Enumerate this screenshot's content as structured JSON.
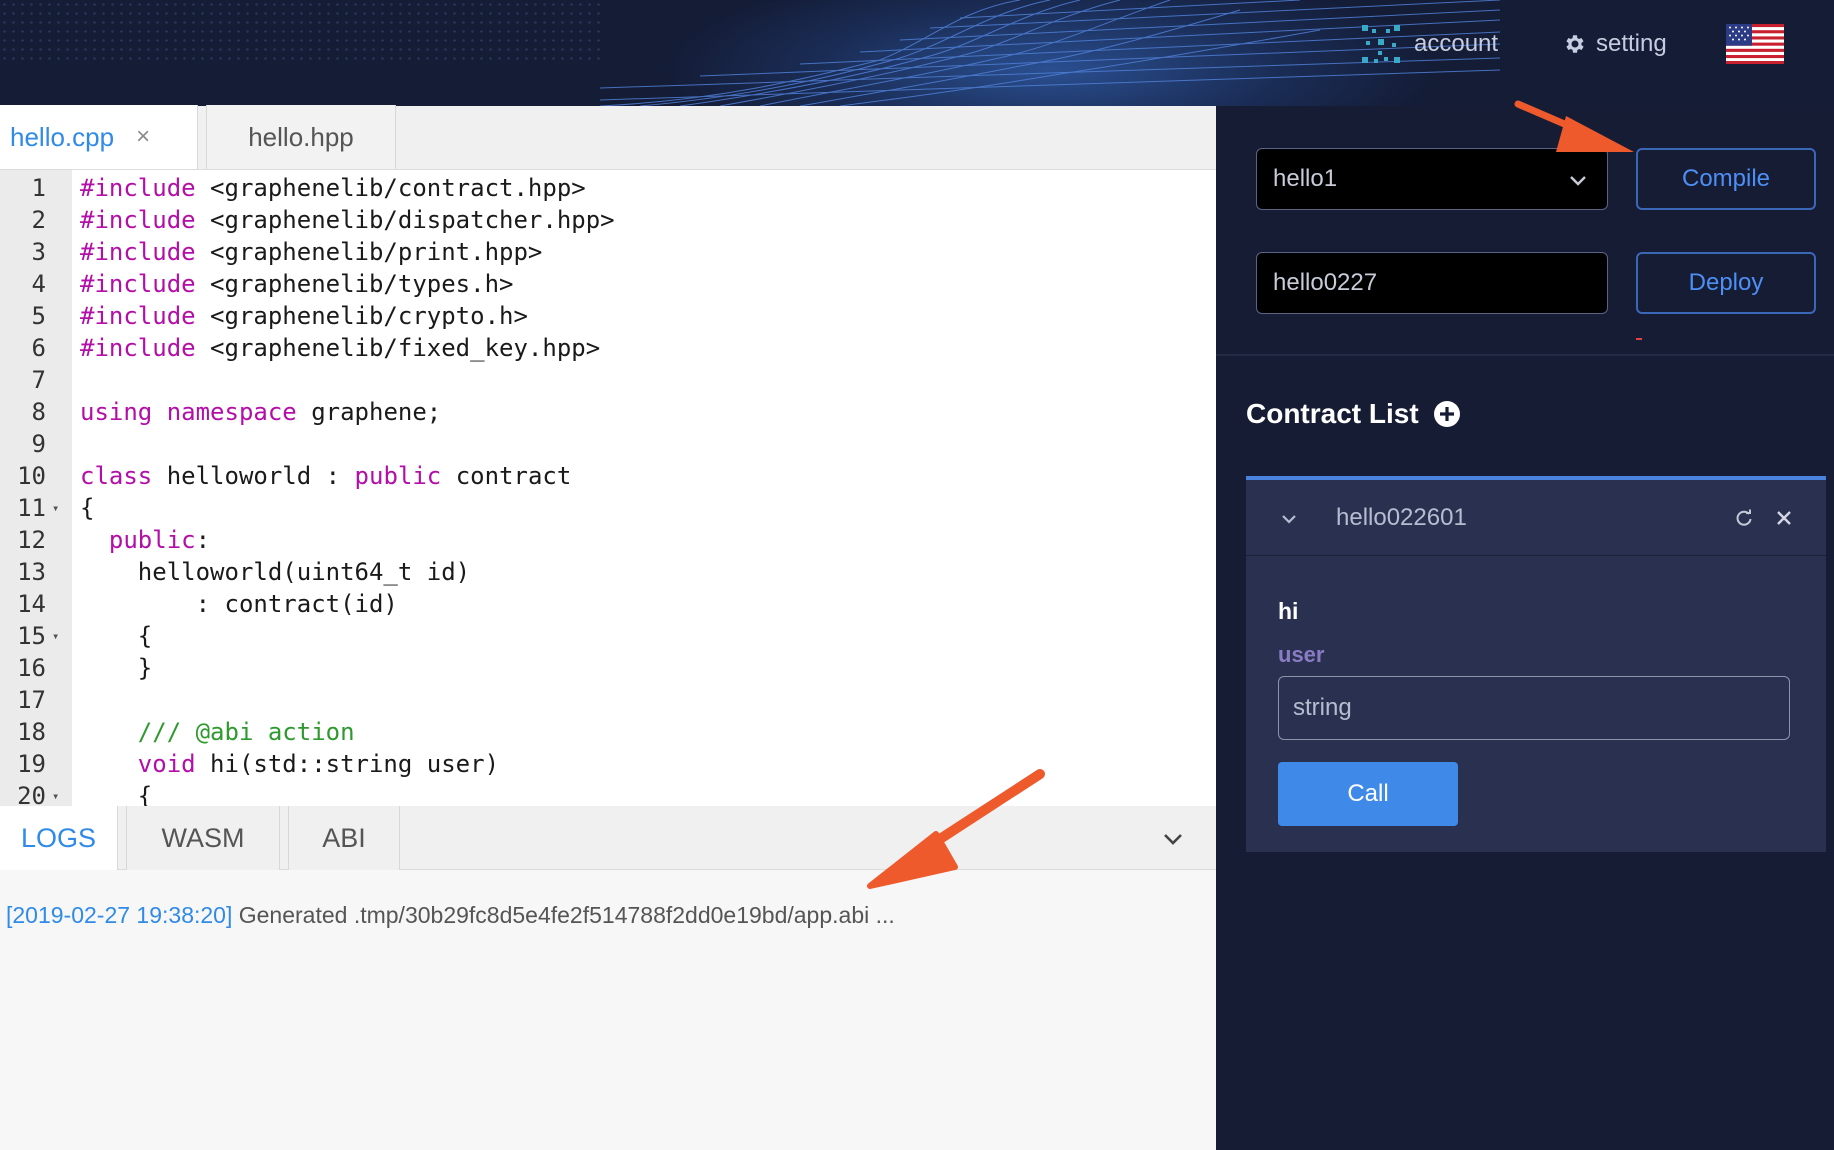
{
  "topbar": {
    "account_label": "account",
    "setting_label": "setting",
    "language_flag": "us-flag-icon"
  },
  "editor": {
    "tabs": [
      {
        "label": "hello.cpp",
        "active": true,
        "closable": true
      },
      {
        "label": "hello.hpp",
        "active": false,
        "closable": false
      }
    ],
    "lines": [
      {
        "n": "1",
        "fold": false,
        "parts": [
          [
            "kw",
            "#include"
          ],
          [
            "",
            " <graphenelib/contract.hpp>"
          ]
        ]
      },
      {
        "n": "2",
        "fold": false,
        "parts": [
          [
            "kw",
            "#include"
          ],
          [
            "",
            " <graphenelib/dispatcher.hpp>"
          ]
        ]
      },
      {
        "n": "3",
        "fold": false,
        "parts": [
          [
            "kw",
            "#include"
          ],
          [
            "",
            " <graphenelib/print.hpp>"
          ]
        ]
      },
      {
        "n": "4",
        "fold": false,
        "parts": [
          [
            "kw",
            "#include"
          ],
          [
            "",
            " <graphenelib/types.h>"
          ]
        ]
      },
      {
        "n": "5",
        "fold": false,
        "parts": [
          [
            "kw",
            "#include"
          ],
          [
            "",
            " <graphenelib/crypto.h>"
          ]
        ]
      },
      {
        "n": "6",
        "fold": false,
        "parts": [
          [
            "kw",
            "#include"
          ],
          [
            "",
            " <graphenelib/fixed_key.hpp>"
          ]
        ]
      },
      {
        "n": "7",
        "fold": false,
        "parts": []
      },
      {
        "n": "8",
        "fold": false,
        "parts": [
          [
            "kw",
            "using"
          ],
          [
            "",
            " "
          ],
          [
            "kw",
            "namespace"
          ],
          [
            "",
            " graphene;"
          ]
        ]
      },
      {
        "n": "9",
        "fold": false,
        "parts": []
      },
      {
        "n": "10",
        "fold": false,
        "parts": [
          [
            "kw",
            "class"
          ],
          [
            "",
            " helloworld : "
          ],
          [
            "kw",
            "public"
          ],
          [
            "",
            " contract"
          ]
        ]
      },
      {
        "n": "11",
        "fold": true,
        "parts": [
          [
            "",
            "{"
          ]
        ]
      },
      {
        "n": "12",
        "fold": false,
        "parts": [
          [
            "",
            "  "
          ],
          [
            "kw",
            "public"
          ],
          [
            "",
            ":"
          ]
        ]
      },
      {
        "n": "13",
        "fold": false,
        "parts": [
          [
            "",
            "    helloworld(uint64_t id)"
          ]
        ]
      },
      {
        "n": "14",
        "fold": false,
        "parts": [
          [
            "",
            "        : contract(id)"
          ]
        ]
      },
      {
        "n": "15",
        "fold": true,
        "parts": [
          [
            "",
            "    {"
          ]
        ]
      },
      {
        "n": "16",
        "fold": false,
        "parts": [
          [
            "",
            "    }"
          ]
        ]
      },
      {
        "n": "17",
        "fold": false,
        "parts": []
      },
      {
        "n": "18",
        "fold": false,
        "parts": [
          [
            "cm",
            "    /// @abi action"
          ]
        ]
      },
      {
        "n": "19",
        "fold": false,
        "parts": [
          [
            "",
            "    "
          ],
          [
            "kw",
            "void"
          ],
          [
            "",
            " hi(std::string user)"
          ]
        ]
      },
      {
        "n": "20",
        "fold": true,
        "parts": [
          [
            "",
            "    {"
          ]
        ]
      }
    ]
  },
  "logs": {
    "tabs": [
      "LOGS",
      "WASM",
      "ABI"
    ],
    "active_tab": "LOGS",
    "entries": [
      {
        "time": "[2019-02-27 19:38:20]",
        "message": " Generated .tmp/30b29fc8d5e4fe2f514788f2dd0e19bd/app.abi ..."
      }
    ]
  },
  "controls": {
    "contract_select_value": "hello1",
    "account_input_value": "hello0227",
    "compile_label": "Compile",
    "deploy_label": "Deploy"
  },
  "contract_list": {
    "title": "Contract List",
    "add_icon": "plus-circle-icon",
    "contracts": [
      {
        "name": "hello022601",
        "method": "hi",
        "param_label": "user",
        "param_placeholder": "string",
        "call_label": "Call"
      }
    ]
  },
  "colors": {
    "accent_blue": "#2f8ae8",
    "keyword": "#b30ea8",
    "comment": "#2e9a2e",
    "panel_bg": "#161c33",
    "card_bg": "#2a3150",
    "annotation_arrow": "#ee5a2c"
  }
}
